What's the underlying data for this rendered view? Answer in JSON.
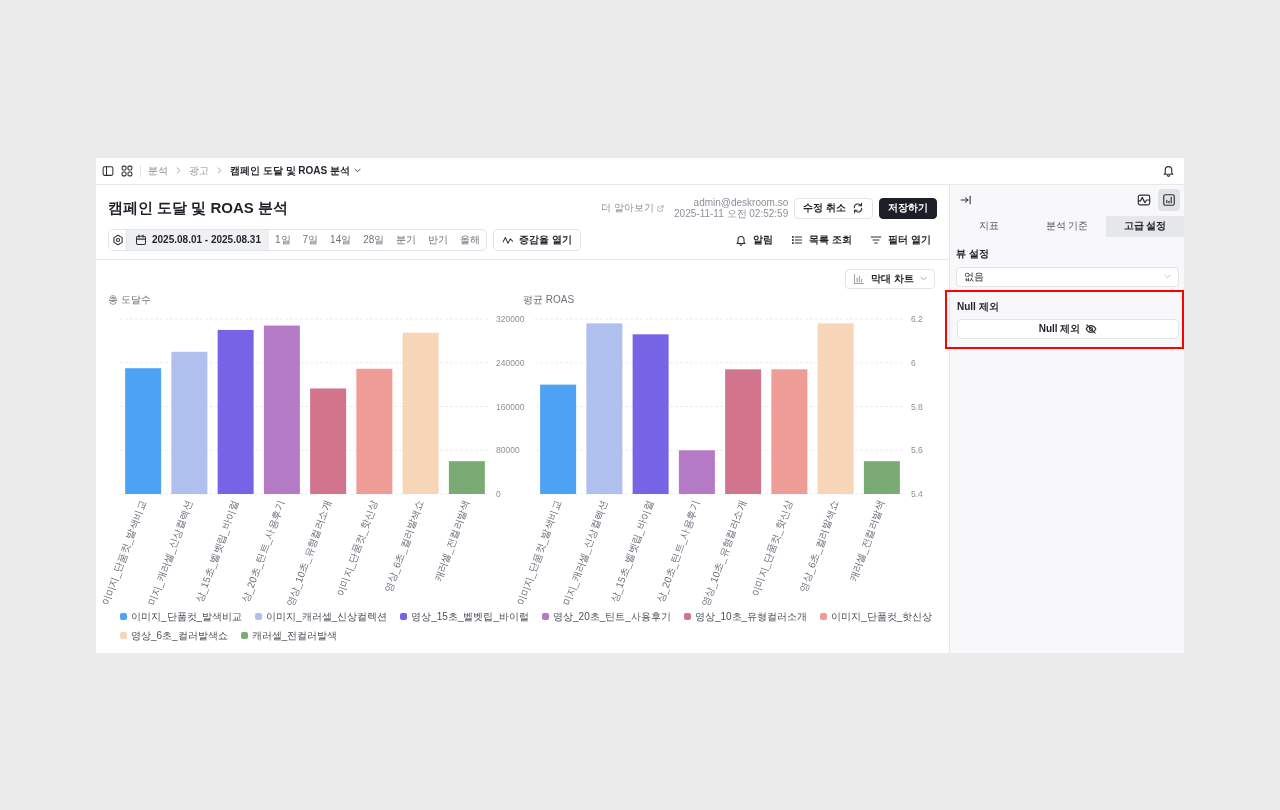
{
  "topbar": {
    "breadcrumb": [
      {
        "label": "분석",
        "current": false
      },
      {
        "label": "광고",
        "current": false
      },
      {
        "label": "캠페인 도달 및 ROAS 분석",
        "current": true
      }
    ]
  },
  "header": {
    "title": "캠페인 도달 및 ROAS 분석",
    "learn_more": "더 알아보기",
    "user": "admin@deskroom.so",
    "saved_at": "2025-11-11 오전 02:52:59",
    "buttons": [
      {
        "label": "수정 취소",
        "kind": "secondary"
      },
      {
        "label": "저장하기",
        "kind": "primary"
      }
    ]
  },
  "toolbar": {
    "date_range": "2025.08.01 - 2025.08.31",
    "presets": [
      {
        "label": "1일",
        "selected": false
      },
      {
        "label": "7일",
        "selected": false
      },
      {
        "label": "14일",
        "selected": false
      },
      {
        "label": "28일",
        "selected": false
      },
      {
        "label": "분기",
        "selected": false
      },
      {
        "label": "반기",
        "selected": false
      },
      {
        "label": "올해",
        "selected": false
      }
    ],
    "trend_button": "증감율 열기",
    "actions": [
      {
        "label": "알림",
        "kind": "bell"
      },
      {
        "label": "목록 조회",
        "kind": "list"
      },
      {
        "label": "필터 열기",
        "kind": "filter"
      }
    ]
  },
  "chart_type": "막대 차트",
  "charts": [
    {
      "chart_data": {
        "type": "bar",
        "title": "총 도달수",
        "categories": [
          "이미지_단품컷_발색비교",
          "미지_캐러셀_신상컬렉션",
          "상_15초_벨벳립_바이럴",
          "상_20초_틴트_사용후기",
          "영상_10초_유형컬러소개",
          "이미지_단품컷_핫신상",
          "영상_6초_컬러발색쇼",
          "캐러셀_전컬러발색"
        ],
        "values": [
          230000,
          260000,
          300000,
          308000,
          193000,
          229000,
          295000,
          60000
        ],
        "ylim": [
          0,
          320000
        ],
        "yticks": [
          0,
          80000,
          160000,
          240000,
          320000
        ],
        "grid": true
      }
    },
    {
      "chart_data": {
        "type": "bar",
        "title": "평균 ROAS",
        "categories": [
          "이미지_단품컷_발색비교",
          "미지_캐러셀_신상컬렉션",
          "상_15초_벨벳립_바이럴",
          "상_20초_틴트_사용후기",
          "영상_10초_유형컬러소개",
          "이미지_단품컷_핫신상",
          "영상_6초_컬러발색쇼",
          "캐러셀_전컬러발색"
        ],
        "values": [
          5.9,
          6.18,
          6.13,
          5.6,
          5.97,
          5.97,
          6.18,
          5.55
        ],
        "ylim": [
          5.4,
          6.2
        ],
        "yticks": [
          5.4,
          5.6,
          5.8,
          6,
          6.2
        ],
        "grid": true
      }
    }
  ],
  "legend": [
    {
      "label": "이미지_단품컷_발색비교",
      "color": "#4ea2f3"
    },
    {
      "label": "이미지_캐러셀_신상컬렉션",
      "color": "#b0c0ee"
    },
    {
      "label": "영상_15초_벨벳립_바이럴",
      "color": "#7763e6"
    },
    {
      "label": "영상_20초_틴트_사용후기",
      "color": "#b57ac6"
    },
    {
      "label": "영상_10초_유형컬러소개",
      "color": "#d2758c"
    },
    {
      "label": "이미지_단품컷_핫신상",
      "color": "#f09c96"
    },
    {
      "label": "영상_6초_컬러발색쇼",
      "color": "#f7d6b7"
    },
    {
      "label": "캐러셀_전컬러발색",
      "color": "#7bab74"
    }
  ],
  "side_panel": {
    "view_modes": [
      {
        "kind": "line_chart",
        "selected": false
      },
      {
        "kind": "bar_chart",
        "selected": true
      }
    ],
    "tabs": [
      {
        "label": "지표",
        "selected": false
      },
      {
        "label": "분석 기준",
        "selected": false
      },
      {
        "label": "고급 설정",
        "selected": true
      }
    ],
    "view_setting": {
      "label": "뷰 설정",
      "value": "없음"
    },
    "null_filter": {
      "label": "Null 제외",
      "button": "Null 제외",
      "highlighted": true
    }
  }
}
